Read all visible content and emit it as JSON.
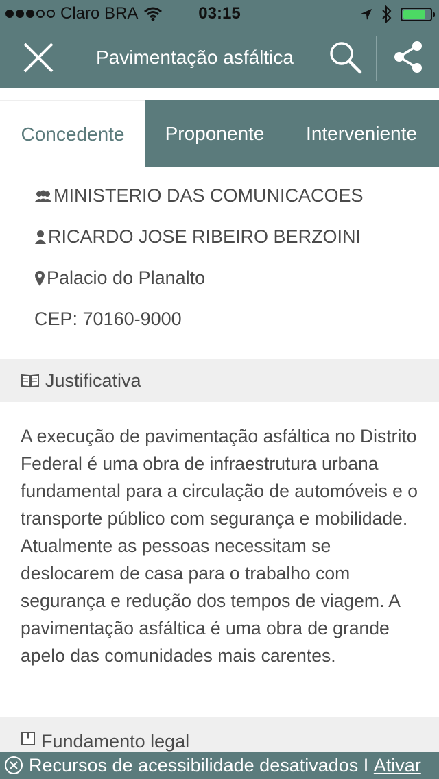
{
  "status_bar": {
    "carrier": "Claro BRA",
    "time": "03:15",
    "signal_bars": 3,
    "battery_level": 0.85
  },
  "navbar": {
    "title": "Pavimentação asfáltica",
    "close_icon": "close-icon",
    "search_icon": "search-icon",
    "share_icon": "share-icon"
  },
  "tabs": [
    {
      "label": "Concedente",
      "active": true
    },
    {
      "label": "Proponente",
      "active": false
    },
    {
      "label": "Interveniente",
      "active": false
    }
  ],
  "concedente": {
    "organization": "MINISTERIO DAS COMUNICACOES",
    "person": "RICARDO JOSE RIBEIRO BERZOINI",
    "address": "Palacio do Planalto",
    "cep": "CEP: 70160-9000"
  },
  "justificativa": {
    "heading": "Justificativa",
    "text": "A execução de pavimentação asfáltica no Distrito Federal é uma obra de infraestrutura urbana fundamental para a circulação de automóveis e o transporte público com segurança e mobilidade. Atualmente as pessoas necessitam se deslocarem de casa para o trabalho com segurança e redução dos tempos de viagem. A pavimentação asfáltica é uma obra de grande apelo das comunidades mais carentes."
  },
  "fundamento": {
    "heading": "Fundamento legal"
  },
  "accessibility_bar": {
    "message": "Recursos de acessibilidade desativados I",
    "action": "Ativar"
  },
  "colors": {
    "primary": "#5b7b7c",
    "section_bg": "#efefef",
    "text": "#4a4a4a",
    "battery": "#4cd964"
  }
}
